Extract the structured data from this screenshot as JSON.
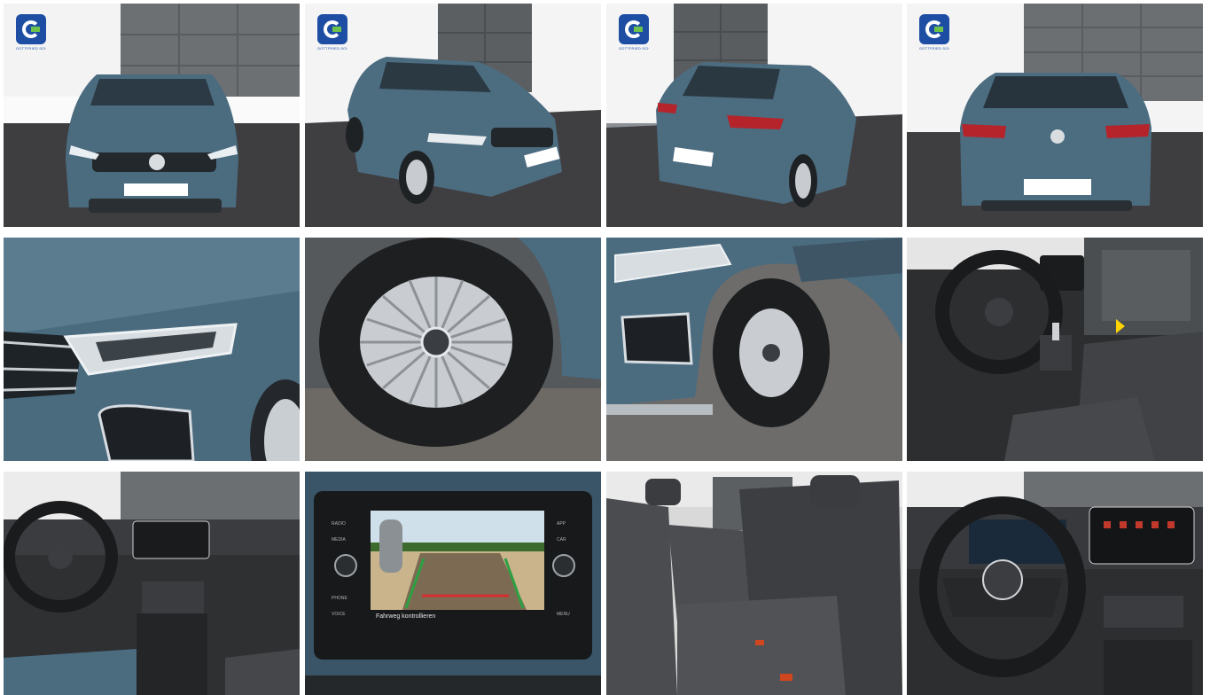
{
  "gallery": {
    "logo_text": "GOTTFRIED SCHULTZ GRUPPE",
    "camera_warning": "Fahrweg kontrollieren",
    "infotainment_labels": [
      "RADIO",
      "MEDIA",
      "PHONE",
      "VOICE",
      "APP",
      "CAR",
      "MENU"
    ],
    "photos": [
      {
        "icon": "car-front"
      },
      {
        "icon": "car-front-left"
      },
      {
        "icon": "car-rear-left"
      },
      {
        "icon": "car-rear"
      },
      {
        "icon": "headlight-detail"
      },
      {
        "icon": "alloy-wheel"
      },
      {
        "icon": "front-wheel-fender"
      },
      {
        "icon": "driver-cockpit"
      },
      {
        "icon": "dashboard-wide"
      },
      {
        "icon": "rear-camera-display"
      },
      {
        "icon": "rear-seats"
      },
      {
        "icon": "steering-wheel-closeup"
      }
    ]
  },
  "colors": {
    "car_body": "#4a6b7e",
    "backdrop_panels": "#6c6f72",
    "floor": "#3d3d3f",
    "wall": "#f2f2f2",
    "logo_blue": "#1d4ea3",
    "logo_green": "#6cc24a"
  }
}
